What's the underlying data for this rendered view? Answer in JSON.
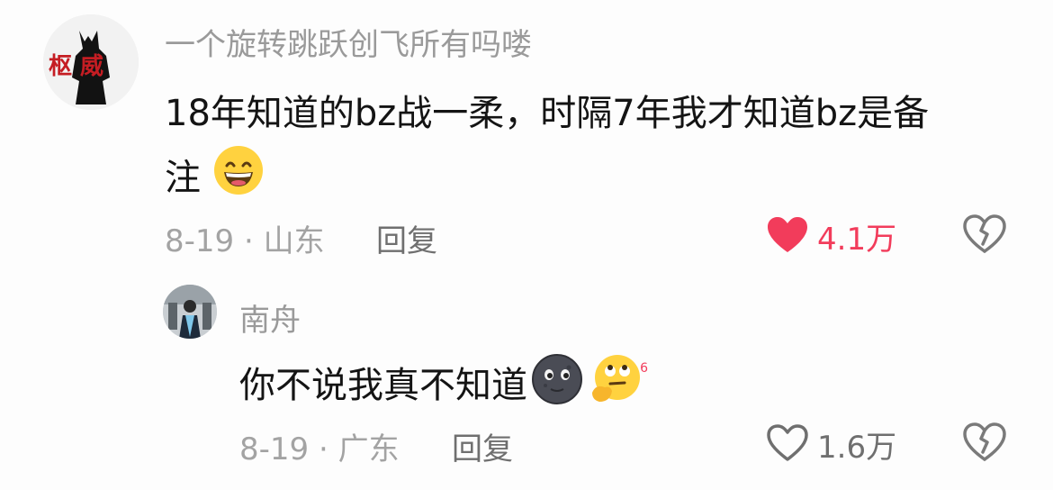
{
  "comment": {
    "username": "一个旋转跳跃创飞所有吗喽",
    "avatar_text": "枢 威",
    "text_line1": "18年知道的bz战一柔，时隔7年我才知道bz是备",
    "text_line2": "注",
    "emoji": "grinning-smiling-eyes",
    "date_location": "8-19 · 山东",
    "reply_label": "回复",
    "likes": "4.1万",
    "liked": true,
    "like_color": "#f23c5b"
  },
  "reply": {
    "username": "南舟",
    "text": "你不说我真不知道",
    "emojis": [
      "new-moon-face",
      "thinking-rolling-eyes"
    ],
    "emoji_badge": "6",
    "date_location": "8-19 · 广东",
    "reply_label": "回复",
    "likes": "1.6万",
    "liked": false
  }
}
